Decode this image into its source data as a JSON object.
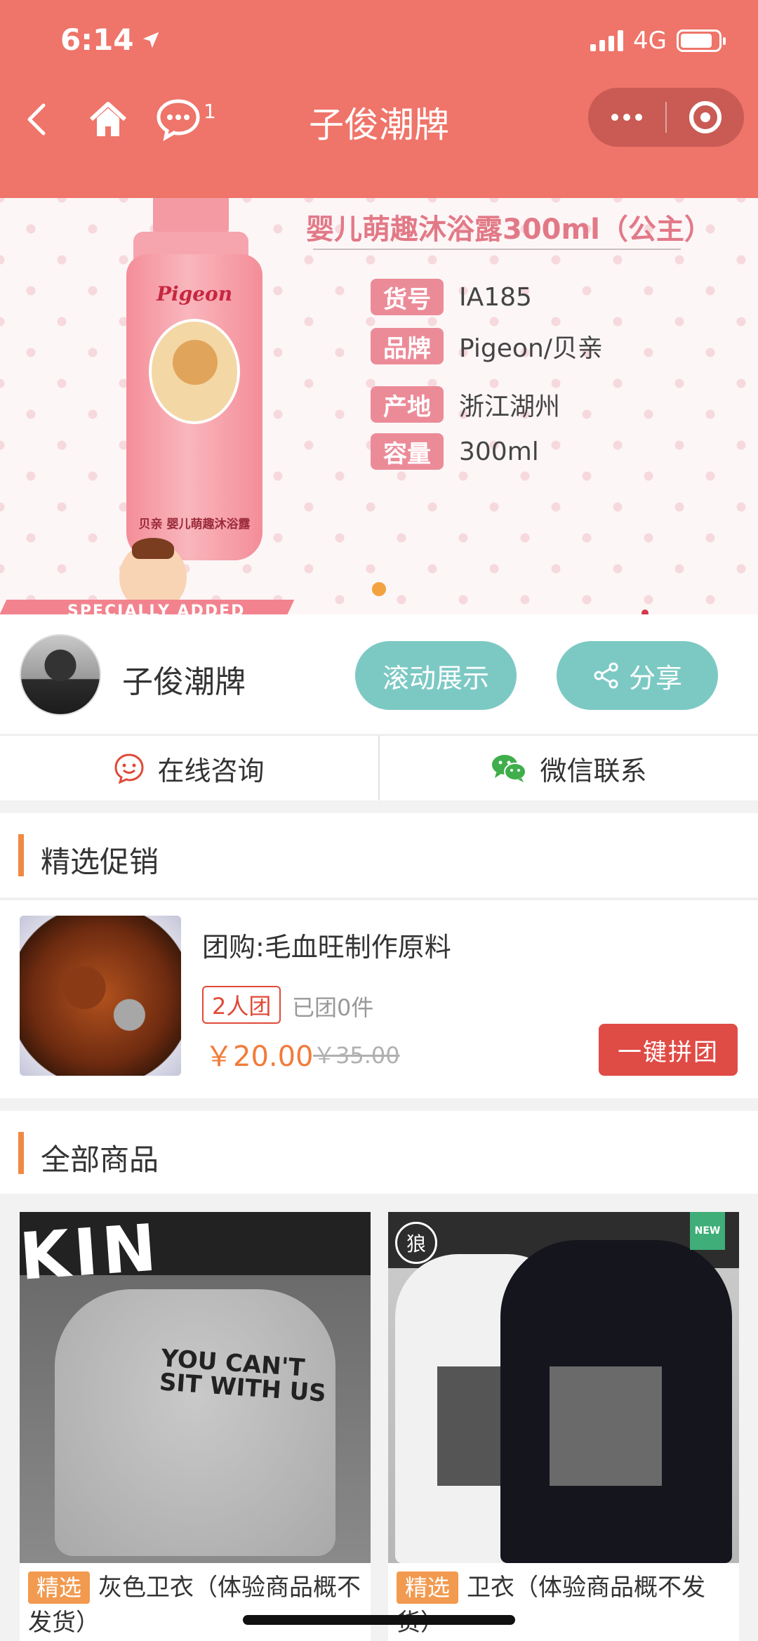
{
  "status_bar": {
    "time": "6:14",
    "network": "4G",
    "battery_level": 0.85
  },
  "nav": {
    "title": "子俊潮牌",
    "message_count": "1"
  },
  "banner": {
    "product_title": "婴儿萌趣沐浴露300ml（公主）",
    "specs": [
      {
        "tag": "货号",
        "value": "IA185"
      },
      {
        "tag": "品牌",
        "value": "Pigeon/贝亲"
      },
      {
        "tag": "产地",
        "value": "浙江湖州"
      },
      {
        "tag": "容量",
        "value": "300ml"
      }
    ],
    "bottle_brand": "Pigeon",
    "bottle_subtitle": "贝亲 婴儿萌趣沐浴露",
    "ribbon_text": "SPECIALLY ADDED"
  },
  "shop": {
    "name": "子俊潮牌",
    "scroll_button": "滚动展示",
    "share_button": "分享"
  },
  "contact": {
    "online": "在线咨询",
    "wechat": "微信联系"
  },
  "promo": {
    "section_title": "精选促销",
    "item": {
      "title": "团购:毛血旺制作原料",
      "group_tag": "2人团",
      "sold": "已团0件",
      "price": "￥20.00",
      "original_price": "￥35.00",
      "button": "一键拼团"
    }
  },
  "products": {
    "section_title": "全部商品",
    "items": [
      {
        "tag": "精选",
        "title": "灰色卫衣（体验商品概不发货）",
        "image_text": "YOU CAN'T SIT WITH US",
        "banner_text": "KIN"
      },
      {
        "tag": "精选",
        "title": "卫衣（体验商品概不发货）",
        "badge": "NEW",
        "logo_text": "狼"
      }
    ]
  },
  "colors": {
    "header": "#ef7469",
    "teal": "#7cc9c4",
    "accent_orange": "#f08a43",
    "price": "#f27b3b",
    "button_red": "#df4b45"
  }
}
